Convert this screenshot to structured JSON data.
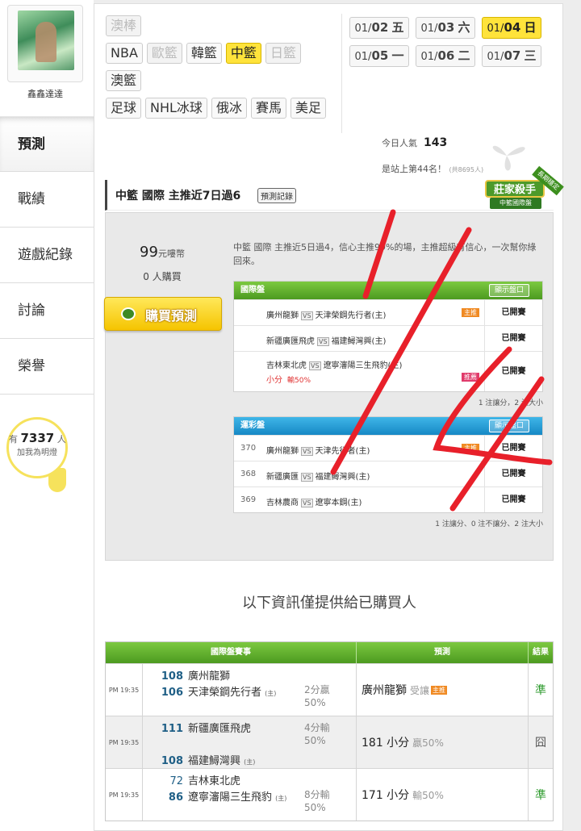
{
  "user": {
    "name": "鑫鑫達達"
  },
  "menu": [
    {
      "label": "預測",
      "active": true
    },
    {
      "label": "戰績",
      "active": false
    },
    {
      "label": "遊戲紀錄",
      "active": false
    },
    {
      "label": "討論",
      "active": false
    },
    {
      "label": "榮譽",
      "active": false
    }
  ],
  "bulb": {
    "prefix": "有",
    "count": "7337",
    "suffix": "人",
    "sub": "加我為明燈"
  },
  "leagues": {
    "row1": [
      "澳棒"
    ],
    "row2": [
      "NBA",
      "歐籃",
      "韓籃",
      "中籃",
      "日籃"
    ],
    "row3": [
      "澳籃"
    ],
    "row4": [
      "足球",
      "NHL冰球",
      "俄冰",
      "賽馬",
      "美足"
    ],
    "active": "中籃",
    "disabled": [
      "澳棒",
      "歐籃",
      "日籃"
    ]
  },
  "dates": [
    {
      "md": "01/",
      "d": "02",
      "w": "五"
    },
    {
      "md": "01/",
      "d": "03",
      "w": "六"
    },
    {
      "md": "01/",
      "d": "04",
      "w": "日",
      "active": true
    },
    {
      "md": "01/",
      "d": "05",
      "w": "一"
    },
    {
      "md": "01/",
      "d": "06",
      "w": "二"
    },
    {
      "md": "01/",
      "d": "07",
      "w": "三"
    }
  ],
  "popularity": {
    "label": "今日人氣",
    "value": "143"
  },
  "rank": {
    "text": "是站上第44名！",
    "small": "(共8695人)"
  },
  "prediction": {
    "title": "中籃 國際 主推近7日過6",
    "record_btn": "預測記錄",
    "badge_main": "莊家殺手",
    "badge_sub": "中籃國際盤",
    "badge_ribbon": "長期穩定",
    "price": "99",
    "price_unit": "元嘍幣",
    "buyers": "0 人購買",
    "buy_btn": "購買預測",
    "desc": "中籃 國際 主推近5日過4，信心主推99%的場，主推超級有信心，一次幫你綠回來。"
  },
  "intl": {
    "header": "國際盤",
    "show": "顯示盤口",
    "rows": [
      {
        "num": "",
        "home": "廣州龍獅",
        "away": "天津榮鋼先行者(主)",
        "tag": "主推",
        "status": "已開賽"
      },
      {
        "num": "",
        "home": "新疆廣匯飛虎",
        "away": "福建鱘灣興(主)",
        "tag": "",
        "status": "已開賽"
      },
      {
        "num": "",
        "home": "吉林東北虎",
        "away": "遼寧瀋陽三生飛豹(主)",
        "tag": "",
        "status": "已開賽",
        "extra_main": "小分",
        "extra_sub": "輸50%",
        "pink": "推薦"
      }
    ],
    "note": "1 注讓分，2 注大小"
  },
  "lottery": {
    "header": "運彩盤",
    "show": "顯示盤口",
    "rows": [
      {
        "num": "370",
        "home": "廣州龍獅",
        "away": "天津先行者(主)",
        "tag": "主推",
        "status": "已開賽"
      },
      {
        "num": "368",
        "home": "新疆廣匯",
        "away": "福建鱘灣興(主)",
        "tag": "",
        "status": "已開賽"
      },
      {
        "num": "369",
        "home": "吉林農商",
        "away": "遼寧本鋼(主)",
        "tag": "",
        "status": "已開賽"
      }
    ],
    "note": "1 注讓分、0 注不讓分、2 注大小"
  },
  "info_title": "以下資訊僅提供給已購買人",
  "results": {
    "headers": [
      "國際盤賽事",
      "預測",
      "結果"
    ],
    "rows": [
      {
        "time": "PM 19:35",
        "s1": "108",
        "t1": "廣州龍獅",
        "s2": "106",
        "t2": "天津榮鋼先行者",
        "line": "2分贏",
        "pct": "50%",
        "pred": "廣州龍獅",
        "pred_grey": "受讓",
        "pred_tag": "主推",
        "result": "準"
      },
      {
        "time": "PM 19:35",
        "s1": "111",
        "t1": "新疆廣匯飛虎",
        "s2": "108",
        "t2": "福建鱘灣興",
        "line": "4分輸",
        "pct": "50%",
        "pred": "181 小分",
        "pred_grey": "贏50%",
        "pred_tag": "",
        "result": "囧"
      },
      {
        "time": "PM 19:35",
        "s1": "72",
        "t1": "吉林東北虎",
        "s2": "86",
        "t2": "遼寧瀋陽三生飛豹",
        "line": "8分輸",
        "pct": "50%",
        "pred": "171 小分",
        "pred_grey": "輸50%",
        "pred_tag": "",
        "result": "準"
      }
    ]
  },
  "colors": {
    "accent_yellow": "#ffe33b",
    "green": "#4c9a20",
    "blue": "#1688c5",
    "scribble": "#e8202a"
  }
}
